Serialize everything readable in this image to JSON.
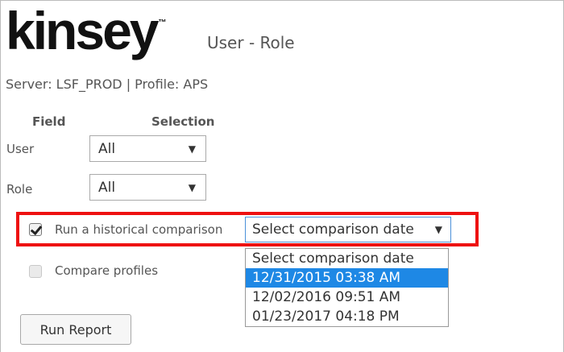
{
  "logo": {
    "text": "kinsey",
    "tm": "™"
  },
  "page_title": "User - Role",
  "server_line": "Server: LSF_PROD | Profile: APS",
  "columns": {
    "field": "Field",
    "selection": "Selection"
  },
  "fields": [
    {
      "label": "User",
      "value": "All"
    },
    {
      "label": "Role",
      "value": "All"
    }
  ],
  "historical": {
    "label": "Run a historical comparison",
    "checked": true,
    "select_value": "Select comparison date",
    "options": [
      "Select comparison date",
      "12/31/2015 03:38 AM",
      "12/02/2016 09:51 AM",
      "01/23/2017 04:18 PM"
    ],
    "highlighted_option": "12/31/2015 03:38 AM",
    "highlight_color": "#ee1111"
  },
  "compare_profiles": {
    "label": "Compare profiles",
    "checked": false
  },
  "run_button": {
    "label": "Run Report"
  },
  "icons": {
    "dropdown_arrow": "▼"
  },
  "colors": {
    "selected_option_bg": "#1e88e5",
    "focus_border": "#4a90d9"
  }
}
